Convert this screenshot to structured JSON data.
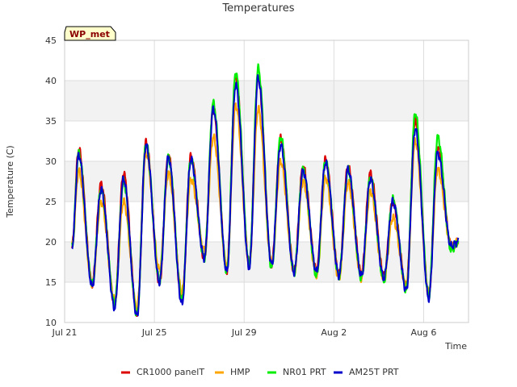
{
  "chart_data": {
    "type": "line",
    "title": "Temperatures",
    "xlabel": "Time",
    "ylabel": "Temperature (C)",
    "site_badge": "WP_met",
    "ylim": [
      10,
      45
    ],
    "yticks": [
      10,
      15,
      20,
      25,
      30,
      35,
      40,
      45
    ],
    "xlim": [
      "2023-07-21",
      "2023-08-08"
    ],
    "xticks": [
      {
        "label": "Jul 21",
        "date": "2023-07-21"
      },
      {
        "label": "Jul 25",
        "date": "2023-07-25"
      },
      {
        "label": "Jul 29",
        "date": "2023-07-29"
      },
      {
        "label": "Aug 2",
        "date": "2023-08-02"
      },
      {
        "label": "Aug 6",
        "date": "2023-08-06"
      }
    ],
    "grid": true,
    "background": "alternating horizontal bands",
    "legend_position": "bottom",
    "daily": {
      "dates": [
        "2023-07-21",
        "2023-07-22",
        "2023-07-23",
        "2023-07-24",
        "2023-07-25",
        "2023-07-26",
        "2023-07-27",
        "2023-07-28",
        "2023-07-29",
        "2023-07-30",
        "2023-07-31",
        "2023-08-01",
        "2023-08-02",
        "2023-08-03",
        "2023-08-04",
        "2023-08-05",
        "2023-08-06",
        "2023-08-07"
      ],
      "start": "2023-07-21T08:00",
      "end": "2023-08-07T13:00",
      "start_value": 19.5,
      "end_value": 20
    },
    "series": [
      {
        "name": "CR1000 panelT",
        "color": "#dd0000",
        "max": [
          31.5,
          27.2,
          28.5,
          32.3,
          30.7,
          30.6,
          36.5,
          40.5,
          40.5,
          32.8,
          29.3,
          30.2,
          29.3,
          28.5,
          25.0,
          35.0,
          31.8,
          20.5
        ],
        "min": [
          17.5,
          14.8,
          12.3,
          11.2,
          15.0,
          12.8,
          18.0,
          16.5,
          17.2,
          17.2,
          16.5,
          16.3,
          16.0,
          16.0,
          15.8,
          14.5,
          13.5,
          19.5
        ]
      },
      {
        "name": "HMP",
        "color": "#ffa500",
        "max": [
          28.8,
          25.0,
          25.0,
          31.0,
          28.5,
          27.8,
          33.0,
          37.0,
          36.5,
          30.0,
          27.5,
          28.0,
          27.3,
          26.3,
          23.0,
          32.5,
          29.0,
          20.0
        ],
        "min": [
          16.8,
          14.8,
          12.8,
          11.8,
          16.5,
          13.8,
          19.0,
          17.0,
          17.5,
          17.2,
          16.3,
          15.8,
          15.5,
          15.5,
          15.3,
          14.5,
          13.8,
          19.5
        ]
      },
      {
        "name": "NR01 PRT",
        "color": "#00ee00",
        "max": [
          31.0,
          26.5,
          27.5,
          32.2,
          30.5,
          30.2,
          37.2,
          41.0,
          41.5,
          33.0,
          29.0,
          30.0,
          29.0,
          28.0,
          25.3,
          36.0,
          33.0,
          20.0
        ],
        "min": [
          16.8,
          14.8,
          12.3,
          11.0,
          15.2,
          12.8,
          18.0,
          16.3,
          17.2,
          16.8,
          16.2,
          15.8,
          15.8,
          15.5,
          15.2,
          14.0,
          13.3,
          19.0
        ]
      },
      {
        "name": "AM25T PRT",
        "color": "#0000cc",
        "max": [
          30.8,
          26.5,
          27.8,
          32.0,
          30.5,
          30.2,
          36.5,
          39.5,
          40.3,
          32.0,
          28.8,
          29.8,
          29.0,
          27.8,
          25.0,
          34.0,
          31.0,
          20.0
        ],
        "min": [
          17.2,
          14.5,
          11.8,
          10.8,
          15.0,
          12.3,
          18.0,
          16.3,
          16.8,
          17.2,
          16.2,
          16.3,
          15.8,
          15.8,
          15.5,
          14.0,
          13.0,
          19.5
        ]
      }
    ]
  }
}
